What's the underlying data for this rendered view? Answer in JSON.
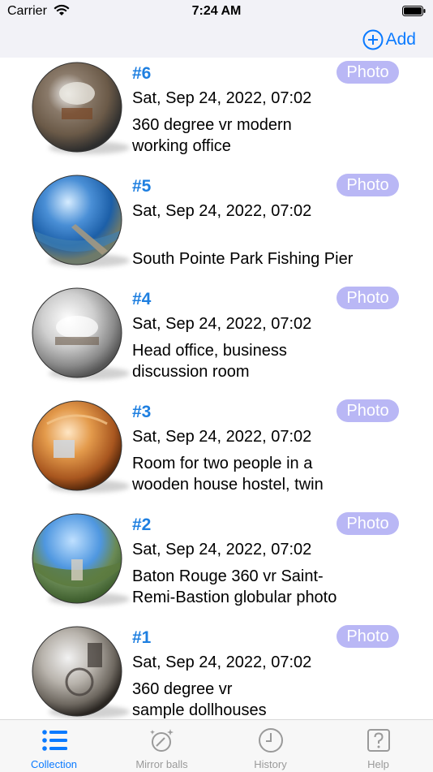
{
  "status_bar": {
    "carrier": "Carrier",
    "time": "7:24 AM"
  },
  "nav": {
    "add_label": "Add"
  },
  "items": [
    {
      "number": "#6",
      "badge": "Photo",
      "date": "Sat, Sep 24, 2022, 07:02",
      "title_lines": [
        "360 degree vr modern",
        "working office"
      ]
    },
    {
      "number": "#5",
      "badge": "Photo",
      "date": "Sat, Sep 24, 2022, 07:02",
      "title_lines": [
        "",
        "South Pointe Park Fishing Pier"
      ]
    },
    {
      "number": "#4",
      "badge": "Photo",
      "date": "Sat, Sep 24, 2022, 07:02",
      "title_lines": [
        "Head office, business",
        "discussion room"
      ]
    },
    {
      "number": "#3",
      "badge": "Photo",
      "date": "Sat, Sep 24, 2022, 07:02",
      "title_lines": [
        "Room for two people in a",
        "wooden house hostel, twin"
      ]
    },
    {
      "number": "#2",
      "badge": "Photo",
      "date": "Sat, Sep 24, 2022, 07:02",
      "title_lines": [
        "Baton Rouge 360 vr Saint-",
        "Remi-Bastion globular photo"
      ]
    },
    {
      "number": "#1",
      "badge": "Photo",
      "date": "Sat, Sep 24, 2022, 07:02",
      "title_lines": [
        "360 degree vr",
        "sample dollhouses"
      ]
    }
  ],
  "tabs": [
    {
      "label": "Collection",
      "icon": "list-icon",
      "active": true
    },
    {
      "label": "Mirror balls",
      "icon": "mirror-ball-icon",
      "active": false
    },
    {
      "label": "History",
      "icon": "clock-icon",
      "active": false
    },
    {
      "label": "Help",
      "icon": "question-icon",
      "active": false
    }
  ],
  "colors": {
    "accent": "#0a7aff",
    "number": "#1e7fe0",
    "badge": "#b9b7f5"
  }
}
